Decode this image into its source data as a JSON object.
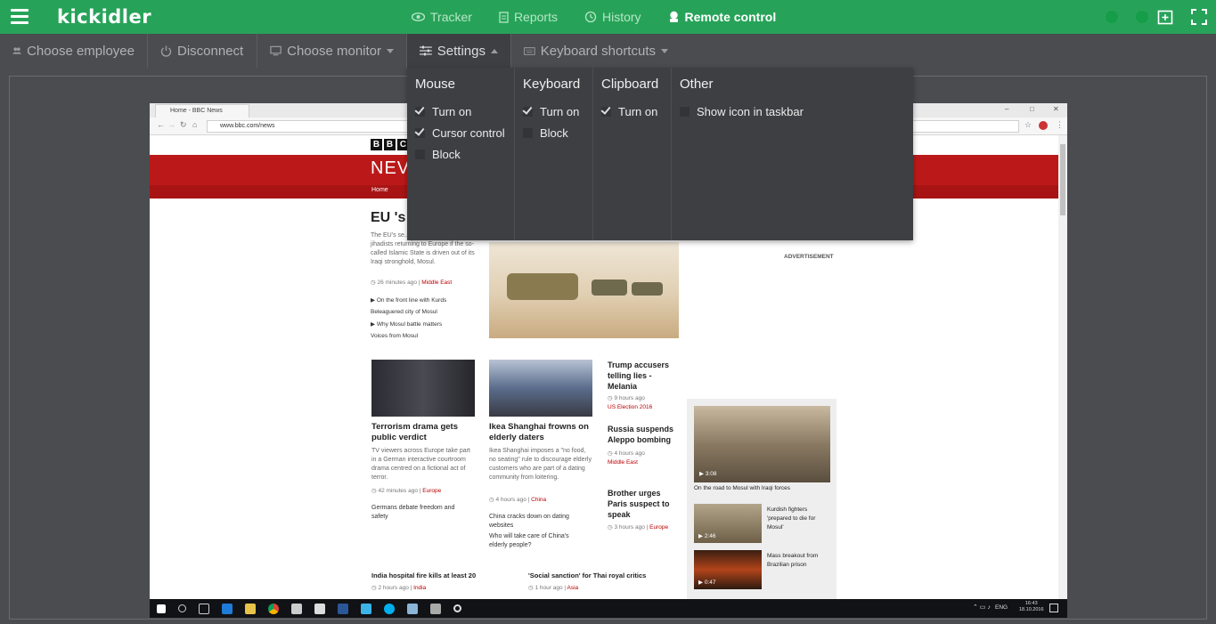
{
  "app": {
    "logo": "kickidler"
  },
  "nav": [
    {
      "label": "Tracker",
      "icon": "eye-icon",
      "active": false
    },
    {
      "label": "Reports",
      "icon": "document-icon",
      "active": false
    },
    {
      "label": "History",
      "icon": "history-icon",
      "active": false
    },
    {
      "label": "Remote control",
      "icon": "joystick-icon",
      "active": true
    }
  ],
  "toolbar": {
    "choose_employee": "Choose employee",
    "disconnect": "Disconnect",
    "choose_monitor": "Choose monitor",
    "settings": "Settings",
    "keyboard_shortcuts": "Keyboard shortcuts"
  },
  "settings": {
    "mouse": {
      "title": "Mouse",
      "options": [
        {
          "label": "Turn on",
          "checked": true
        },
        {
          "label": "Cursor control",
          "checked": true
        },
        {
          "label": "Block",
          "checked": false
        }
      ]
    },
    "keyboard": {
      "title": "Keyboard",
      "options": [
        {
          "label": "Turn on",
          "checked": true
        },
        {
          "label": "Block",
          "checked": false
        }
      ]
    },
    "clipboard": {
      "title": "Clipboard",
      "options": [
        {
          "label": "Turn on",
          "checked": true
        }
      ]
    },
    "other": {
      "title": "Other",
      "options": [
        {
          "label": "Show icon in taskbar",
          "checked": false
        }
      ]
    }
  },
  "remote": {
    "tab_title": "Home - BBC News",
    "url": "www.bbc.com/news",
    "bbc_letters": [
      "B",
      "B",
      "C"
    ],
    "news_word": "NEV",
    "home_link": "Home",
    "lead_title": "EU 's",
    "lead_text": "The EU's se... warns of foreign jihadists returning to Europe if the so-called Islamic State is driven out of its Iraqi stronghold, Mosul.",
    "lead_meta": "26 minutes ago",
    "lead_tag": "Middle East",
    "lead_links": [
      "On the front line with Kurds",
      "Beleaguered city of Mosul",
      "Why Mosul battle matters",
      "Voices from Mosul"
    ],
    "advertisement": "ADVERTISEMENT",
    "story1_title": "Terrorism drama gets public verdict",
    "story1_text": "TV viewers across Europe take part in a German interactive courtroom drama centred on a fictional act of terror.",
    "story1_meta": "42 minutes ago",
    "story1_tag": "Europe",
    "story1_link": "Germans debate freedom and safety",
    "story2_title": "Ikea Shanghai frowns on elderly daters",
    "story2_text": "Ikea Shanghai imposes a \"no food, no seating\" rule to discourage elderly customers who are part of a dating community from loitering.",
    "story2_meta": "4 hours ago",
    "story2_tag": "China",
    "story2_links": [
      "China cracks down on dating websites",
      "Who will take care of China's elderly people?"
    ],
    "side1_title": "Trump accusers telling lies - Melania",
    "side1_meta": "9 hours ago",
    "side1_tag": "US Election 2016",
    "side2_title": "Russia suspends Aleppo bombing",
    "side2_meta": "4 hours ago",
    "side2_tag": "Middle East",
    "side3_title": "Brother urges Paris suspect to speak",
    "side3_meta": "3 hours ago",
    "side3_tag": "Europe",
    "video_main_caption": "On the road to Mosul with Iraqi forces",
    "video_main_time": "3:08",
    "video2_title": "Kurdish fighters 'prepared to die for Mosul'",
    "video2_time": "2:46",
    "video3_title": "Mass breakout from Brazilian prison",
    "video3_time": "0:47",
    "bottom1_title": "India hospital fire kills at least 20",
    "bottom1_meta": "2 hours ago",
    "bottom1_tag": "India",
    "bottom2_title": "'Social sanction' for Thai royal critics",
    "bottom2_meta": "1 hour ago",
    "bottom2_tag": "Asia",
    "tray_lang": "ENG",
    "tray_time": "16:43",
    "tray_date": "18.10.2016"
  },
  "colors": {
    "brand": "#27a359",
    "toolbar_bg": "#4b4c50",
    "panel_bg": "#3e3f43",
    "bbc_red": "#bb1919"
  }
}
